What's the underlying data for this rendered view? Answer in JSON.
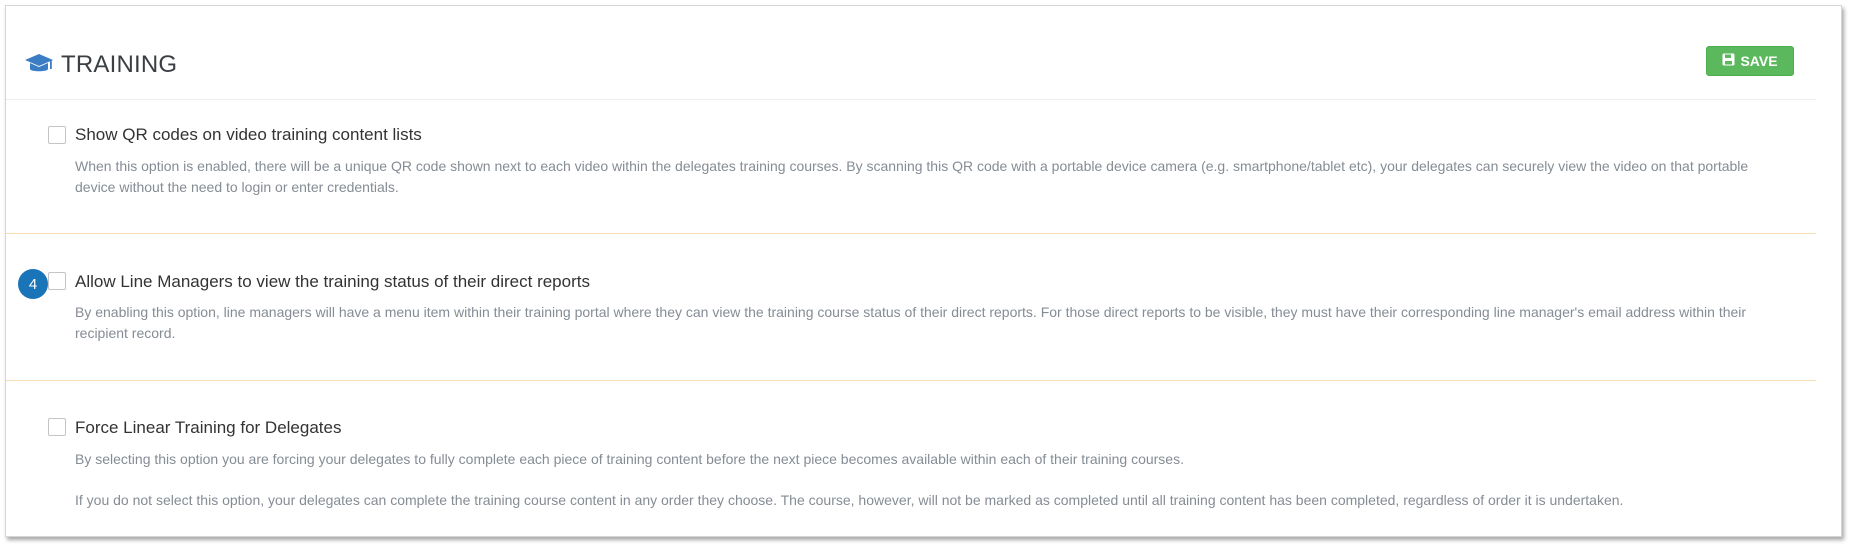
{
  "header": {
    "title": "TRAINING",
    "title_icon": "graduation-cap-icon",
    "save_label": "SAVE",
    "save_icon": "floppy-disk-icon",
    "accent_color": "#5cb85c",
    "icon_color": "#3b7dc4"
  },
  "options": [
    {
      "label": "Show QR codes on video training content lists",
      "checked": false,
      "description": "When this option is enabled, there will be a unique QR code shown next to each video within the delegates training courses. By scanning this QR code with a portable device camera (e.g. smartphone/tablet etc), your delegates can securely view the video on that portable device without the need to login or enter credentials."
    },
    {
      "label": "Allow Line Managers to view the training status of their direct reports",
      "checked": false,
      "step_badge": "4",
      "description": "By enabling this option, line managers will have a menu item within their training portal where they can view the training course status of their direct reports. For those direct reports to be visible, they must have their corresponding line manager's email address within their recipient record."
    },
    {
      "label": "Force Linear Training for Delegates",
      "checked": false,
      "description": "By selecting this option you are forcing your delegates to fully complete each piece of training content before the next piece becomes available within each of their training courses.",
      "description_2": "If you do not select this option, your delegates can complete the training course content in any order they choose. The course, however, will not be marked as completed until all training content has been completed, regardless of order it is undertaken."
    }
  ],
  "colors": {
    "step_badge": "#1a74b8",
    "divider": "#f7dcb4"
  }
}
